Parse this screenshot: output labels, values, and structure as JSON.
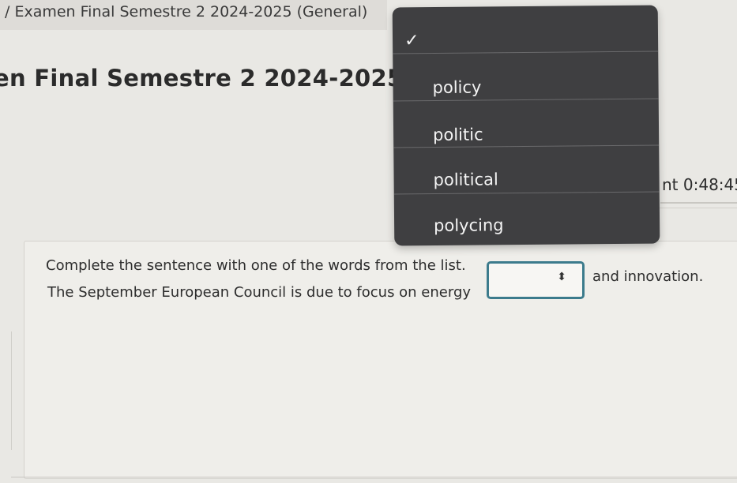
{
  "header": {
    "breadcrumb": "/ Examen Final Semestre 2 2024-2025 (General)",
    "page_title": "en Final Semestre 2 2024-2025 (G",
    "timer": "nt 0:48:45"
  },
  "question": {
    "instruction": "Complete the sentence with one of the words from the list.",
    "sentence_before": "The September European Council is due to focus on energy",
    "sentence_after": "and innovation.",
    "selected_value": ""
  },
  "dropdown": {
    "check_glyph": "✓",
    "options": [
      "policy",
      "politic",
      "political",
      "polycing"
    ]
  },
  "colors": {
    "dropdown_bg": "#3f3f41",
    "select_border": "#3c7b8c"
  }
}
